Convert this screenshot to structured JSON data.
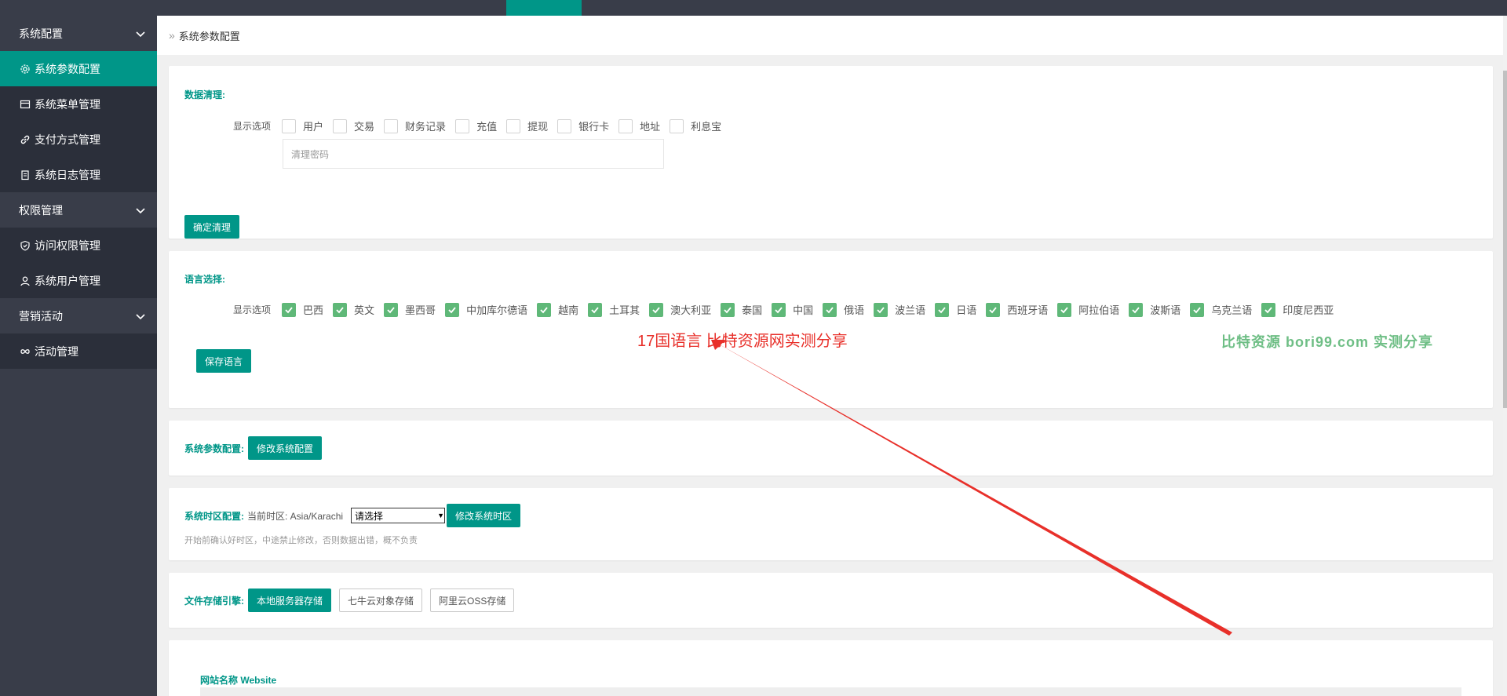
{
  "topbar": {
    "active_tab_color": "#009688",
    "tabs": [
      "",
      "",
      "",
      "",
      "",
      ""
    ]
  },
  "sidebar": {
    "groups": [
      {
        "label": "系统配置",
        "items": [
          {
            "label": "系统参数配置",
            "icon": "gear-icon",
            "active": true
          },
          {
            "label": "系统菜单管理",
            "icon": "table-icon"
          },
          {
            "label": "支付方式管理",
            "icon": "link-icon"
          },
          {
            "label": "系统日志管理",
            "icon": "clipboard-icon"
          }
        ]
      },
      {
        "label": "权限管理",
        "items": [
          {
            "label": "访问权限管理",
            "icon": "shield-icon"
          },
          {
            "label": "系统用户管理",
            "icon": "user-icon"
          }
        ]
      },
      {
        "label": "营销活动",
        "items": [
          {
            "label": "活动管理",
            "icon": "link-icon"
          }
        ]
      }
    ]
  },
  "breadcrumb": {
    "label": "系统参数配置"
  },
  "data_clear": {
    "title": "数据清理:",
    "options_label": "显示选项",
    "options": [
      "用户",
      "交易",
      "财务记录",
      "充值",
      "提现",
      "银行卡",
      "地址",
      "利息宝"
    ],
    "password_placeholder": "清理密码",
    "confirm_label": "确定清理"
  },
  "language": {
    "title": "语言选择:",
    "options_label": "显示选项",
    "options": [
      "巴西",
      "英文",
      "墨西哥",
      "中加库尔德语",
      "越南",
      "土耳其",
      "澳大利亚",
      "泰国",
      "中国",
      "俄语",
      "波兰语",
      "日语",
      "西班牙语",
      "阿拉伯语",
      "波斯语",
      "乌克兰语",
      "印度尼西亚"
    ],
    "save_label": "保存语言"
  },
  "annotation": {
    "text": "17国语言  比特资源网实测分享",
    "color": "#e8302a"
  },
  "watermark": {
    "text": "比特资源  bori99.com  实测分享"
  },
  "sys_params": {
    "title": "系统参数配置:",
    "button_label": "修改系统配置"
  },
  "timezone": {
    "title": "系统时区配置:",
    "current": "当前时区: Asia/Karachi",
    "select_value": "请选择",
    "button_label": "修改系统时区",
    "hint": "开始前确认好时区，中途禁止修改，否则数据出错，概不负责"
  },
  "storage": {
    "title": "文件存储引擎:",
    "options": [
      "本地服务器存储",
      "七牛云对象存储",
      "阿里云OSS存储"
    ],
    "selected": "本地服务器存储"
  },
  "website": {
    "label": "网站名称 Website"
  }
}
